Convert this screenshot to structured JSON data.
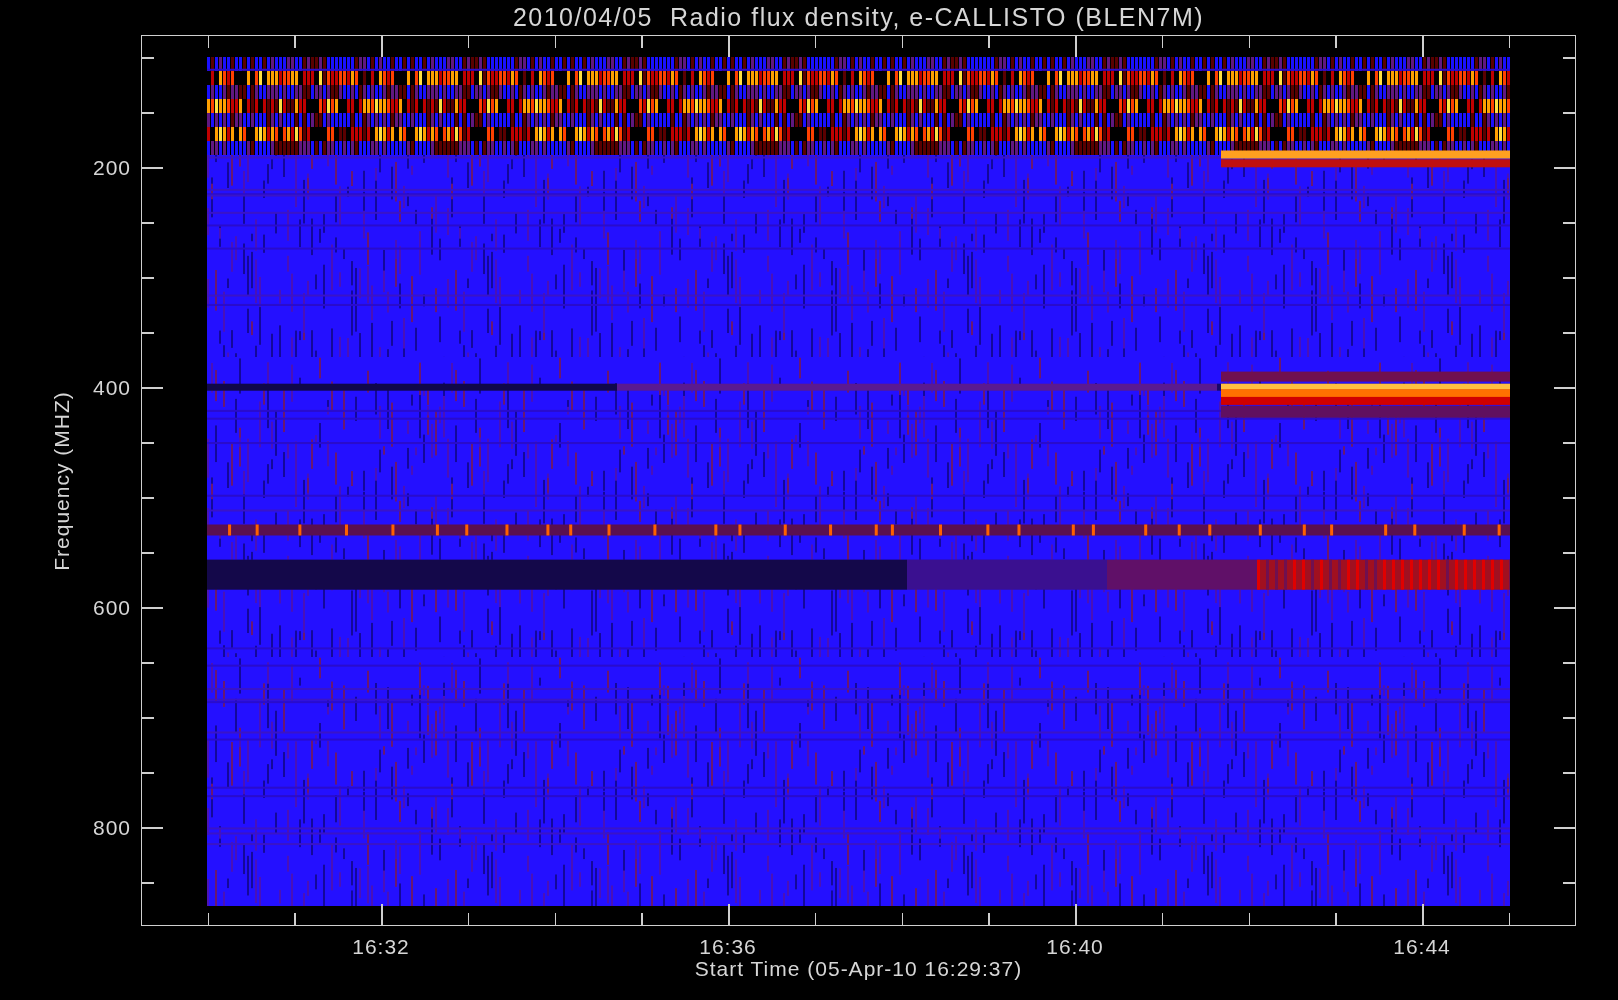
{
  "plot": {
    "title": "2010/04/05  Radio flux density, e-CALLISTO (BLEN7M)",
    "ylabel": "Frequency (MHZ)",
    "xlabel": "Start Time (05-Apr-10 16:29:37)",
    "yticks": [
      "200",
      "400",
      "600",
      "800"
    ],
    "xticks": [
      "16:32",
      "16:36",
      "16:40",
      "16:44"
    ]
  }
}
